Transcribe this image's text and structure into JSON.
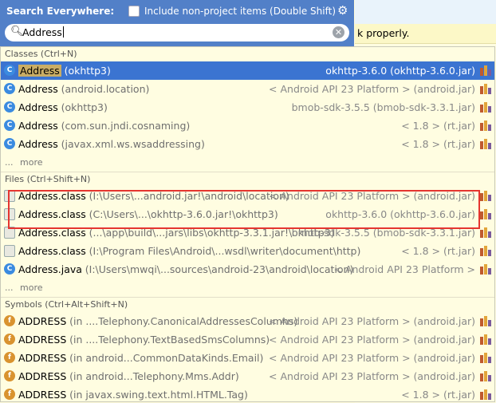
{
  "header": {
    "title": "Search Everywhere:",
    "checkbox_label": "Include non-project items (Double Shift)",
    "checkbox_checked": false
  },
  "search": {
    "value": "Address"
  },
  "background_notice": "k properly.",
  "sections": [
    {
      "title": "Classes (Ctrl+N)",
      "rows": [
        {
          "icon": "class-icon",
          "name": "Address",
          "loc": "(okhttp3)",
          "lib": "okhttp-3.6.0 (okhttp-3.6.0.jar)",
          "selected": true
        },
        {
          "icon": "class-icon",
          "name": "Address",
          "loc": "(android.location)",
          "lib": "< Android API 23 Platform > (android.jar)"
        },
        {
          "icon": "class-icon",
          "name": "Address",
          "loc": "(okhttp3)",
          "lib": "bmob-sdk-3.5.5 (bmob-sdk-3.3.1.jar)"
        },
        {
          "icon": "class-icon",
          "name": "Address",
          "loc": "(com.sun.jndi.cosnaming)",
          "lib": "< 1.8 > (rt.jar)"
        },
        {
          "icon": "class-icon",
          "name": "Address",
          "loc": "(javax.xml.ws.wsaddressing)",
          "lib": "< 1.8 > (rt.jar)"
        }
      ],
      "more": "more"
    },
    {
      "title": "Files (Ctrl+Shift+N)",
      "rows": [
        {
          "icon": "file-icon",
          "name": "Address.class",
          "loc": "(I:\\Users\\...android.jar!\\android\\location)",
          "lib": "< Android API 23 Platform > (android.jar)"
        },
        {
          "icon": "file-icon",
          "name": "Address.class",
          "loc": "(C:\\Users\\...\\okhttp-3.6.0.jar!\\okhttp3)",
          "lib": "okhttp-3.6.0 (okhttp-3.6.0.jar)"
        },
        {
          "icon": "file-icon",
          "name": "Address.class",
          "loc": "(...\\app\\build\\...jars\\libs\\okhttp-3.3.1.jar!\\okhttp3)",
          "lib": "bmob-sdk-3.5.5 (bmob-sdk-3.3.1.jar)"
        },
        {
          "icon": "file-icon",
          "name": "Address.class",
          "loc": "(I:\\Program Files\\Android\\...wsdl\\writer\\document\\http)",
          "lib": "< 1.8 > (rt.jar)"
        },
        {
          "icon": "class-icon",
          "name": "Address.java",
          "loc": "(I:\\Users\\mwqi\\...sources\\android-23\\android\\location)",
          "lib": "< Android API 23 Platform >"
        }
      ],
      "more": "more"
    },
    {
      "title": "Symbols (Ctrl+Alt+Shift+N)",
      "rows": [
        {
          "icon": "symbol-icon",
          "name": "ADDRESS",
          "loc": "(in ....Telephony.CanonicalAddressesColumns)",
          "lib": "< Android API 23 Platform > (android.jar)"
        },
        {
          "icon": "symbol-icon",
          "name": "ADDRESS",
          "loc": "(in ....Telephony.TextBasedSmsColumns)",
          "lib": "< Android API 23 Platform > (android.jar)"
        },
        {
          "icon": "symbol-icon",
          "name": "ADDRESS",
          "loc": "(in android...CommonDataKinds.Email)",
          "lib": "< Android API 23 Platform > (android.jar)"
        },
        {
          "icon": "symbol-icon",
          "name": "ADDRESS",
          "loc": "(in android...Telephony.Mms.Addr)",
          "lib": "< Android API 23 Platform > (android.jar)"
        },
        {
          "icon": "symbol-icon",
          "name": "ADDRESS",
          "loc": "(in javax.swing.text.html.HTML.Tag)",
          "lib": "< 1.8 > (rt.jar)"
        }
      ],
      "more": "more"
    }
  ],
  "colors": {
    "header_bg": "#5280c8",
    "selection_bg": "#3b74d1",
    "highlight_box": "#e53530",
    "panel_bg": "#fffde1"
  }
}
